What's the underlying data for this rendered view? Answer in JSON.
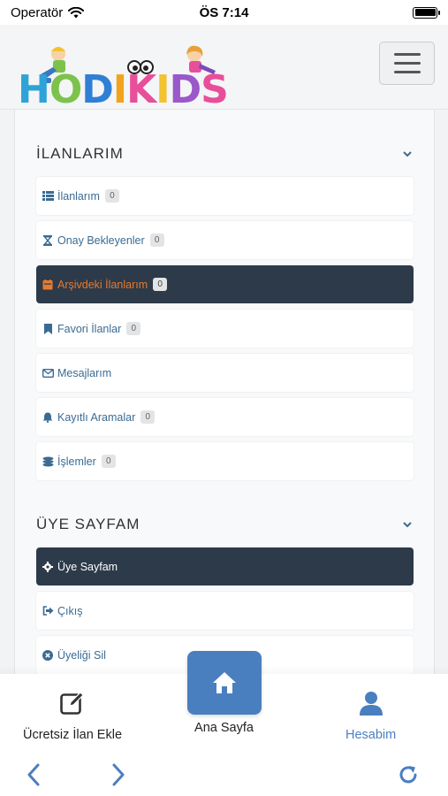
{
  "status_bar": {
    "carrier": "Operatör",
    "time": "ÖS 7:14"
  },
  "header": {
    "logo_text": "HODIKIDS"
  },
  "sections": [
    {
      "title": "İLANLARIM",
      "items": [
        {
          "label": "İlanlarım",
          "icon": "list-icon",
          "badge": "0"
        },
        {
          "label": "Onay Bekleyenler",
          "icon": "hourglass-icon",
          "badge": "0"
        },
        {
          "label": "Arşivdeki İlanlarım",
          "icon": "archive-icon",
          "badge": "0",
          "active": true
        },
        {
          "label": "Favori İlanlar",
          "icon": "bookmark-icon",
          "badge": "0"
        },
        {
          "label": "Mesajlarım",
          "icon": "envelope-icon"
        },
        {
          "label": "Kayıtlı Aramalar",
          "icon": "bell-icon",
          "badge": "0"
        },
        {
          "label": "İşlemler",
          "icon": "coins-icon",
          "badge": "0"
        }
      ]
    },
    {
      "title": "ÜYE SAYFAM",
      "items": [
        {
          "label": "Üye Sayfam",
          "icon": "gear-icon",
          "active": true
        },
        {
          "label": "Çıkış",
          "icon": "sign-out-icon"
        },
        {
          "label": "Üyeliği Sil",
          "icon": "times-circle-icon"
        }
      ]
    }
  ],
  "bottom_nav": {
    "add_label": "Ücretsiz İlan Ekle",
    "home_label": "Ana Sayfa",
    "account_label": "Hesabim"
  },
  "colors": {
    "accent": "#4a7fbf",
    "dark_item": "#2c3a4a",
    "active_orange": "#e87a2c",
    "link": "#3a6b93"
  }
}
